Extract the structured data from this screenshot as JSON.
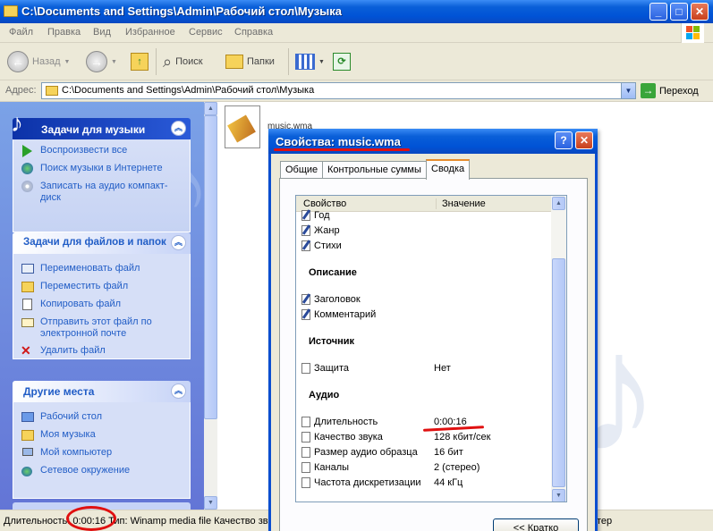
{
  "window": {
    "title": "C:\\Documents and Settings\\Admin\\Рабочий стол\\Музыка",
    "minimize": "_",
    "maximize": "□",
    "close": "✕"
  },
  "menu": [
    "Файл",
    "Правка",
    "Вид",
    "Избранное",
    "Сервис",
    "Справка"
  ],
  "toolbar": {
    "back": "Назад",
    "search": "Поиск",
    "folders": "Папки"
  },
  "address": {
    "label": "Адрес:",
    "value": "C:\\Documents and Settings\\Admin\\Рабочий стол\\Музыка",
    "go": "Переход"
  },
  "tasks_music": {
    "title": "Задачи для музыки",
    "items": [
      "Воспроизвести все",
      "Поиск музыки в Интернете",
      "Записать на аудио компакт-диск"
    ]
  },
  "tasks_files": {
    "title": "Задачи для файлов и папок",
    "items": [
      "Переименовать файл",
      "Переместить файл",
      "Копировать файл",
      "Отправить этот файл по электронной почте",
      "Удалить файл"
    ]
  },
  "other_places": {
    "title": "Другие места",
    "items": [
      "Рабочий стол",
      "Моя музыка",
      "Мой компьютер",
      "Сетевое окружение"
    ]
  },
  "file": {
    "name": "music.wma"
  },
  "status": {
    "text": "Длительность: 0:00:16 Тип: Winamp media file Качество зв",
    "right": "тер"
  },
  "dialog": {
    "title": "Свойства: music.wma",
    "help": "?",
    "close": "✕",
    "tabs": [
      "Общие",
      "Контрольные суммы",
      "Сводка"
    ],
    "columns": {
      "property": "Свойство",
      "value": "Значение"
    },
    "rows_top": [
      "Год",
      "Жанр",
      "Стихи"
    ],
    "section_description": "Описание",
    "rows_description": [
      "Заголовок",
      "Комментарий"
    ],
    "section_source": "Источник",
    "rows_source": [
      {
        "name": "Защита",
        "value": "Нет"
      }
    ],
    "section_audio": "Аудио",
    "rows_audio": [
      {
        "name": "Длительность",
        "value": "0:00:16"
      },
      {
        "name": "Качество звука",
        "value": "128 кбит/сек"
      },
      {
        "name": "Размер аудио образца",
        "value": "16 бит"
      },
      {
        "name": "Каналы",
        "value": "2 (стерео)"
      },
      {
        "name": "Частота дискретизации",
        "value": "44 кГц"
      }
    ],
    "brief_button": "<< Кратко"
  }
}
